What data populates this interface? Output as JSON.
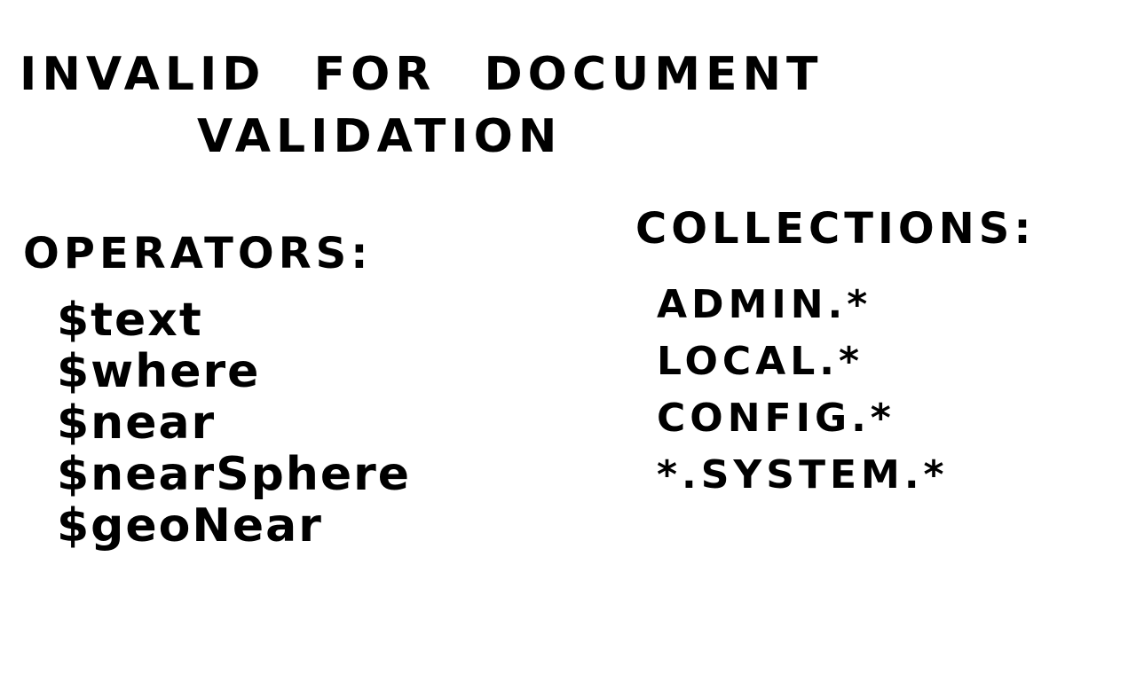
{
  "title": {
    "line1": "INVALID FOR DOCUMENT",
    "line2": "VALIDATION"
  },
  "operators": {
    "heading": "OPERATORS:",
    "items": [
      "$text",
      "$where",
      "$near",
      "$nearSphere",
      "$geoNear"
    ]
  },
  "collections": {
    "heading": "COLLECTIONS:",
    "items": [
      "ADMIN.*",
      "LOCAL.*",
      "CONFIG.*",
      "*.SYSTEM.*"
    ]
  }
}
